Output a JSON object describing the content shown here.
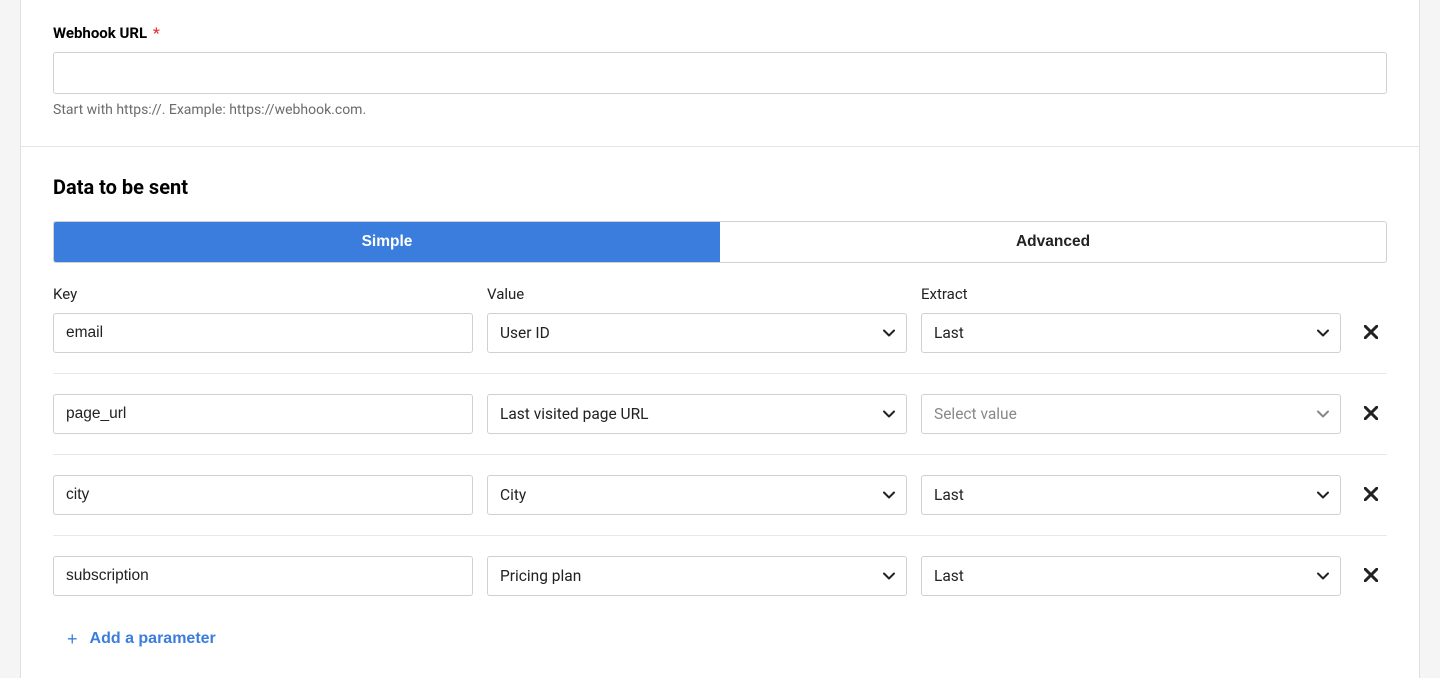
{
  "webhook": {
    "label": "Webhook URL",
    "required_marker": "*",
    "value": "",
    "help": "Start with https://. Example: https://webhook.com."
  },
  "data_section": {
    "title": "Data to be sent",
    "tabs": {
      "simple": "Simple",
      "advanced": "Advanced",
      "active": "simple"
    },
    "columns": {
      "key": "Key",
      "value": "Value",
      "extract": "Extract"
    },
    "extract_placeholder": "Select value",
    "rows": [
      {
        "key": "email",
        "value": "User ID",
        "extract": "Last",
        "extract_empty": false
      },
      {
        "key": "page_url",
        "value": "Last visited page URL",
        "extract": "",
        "extract_empty": true
      },
      {
        "key": "city",
        "value": "City",
        "extract": "Last",
        "extract_empty": false
      },
      {
        "key": "subscription",
        "value": "Pricing plan",
        "extract": "Last",
        "extract_empty": false
      }
    ],
    "add_param_label": "Add a parameter"
  }
}
